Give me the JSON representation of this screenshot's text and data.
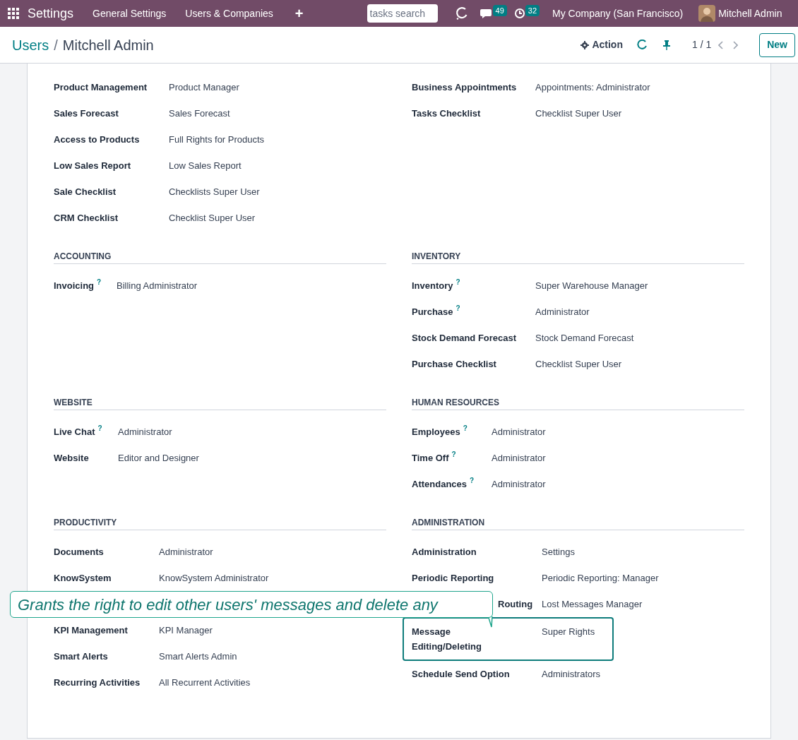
{
  "navbar": {
    "app": "Settings",
    "menu": [
      "General Settings",
      "Users & Companies",
      "+"
    ],
    "search": {
      "placeholder": "tasks search"
    },
    "messages_badge": "49",
    "activities_badge": "32",
    "company": "My Company (San Francisco)",
    "user": "Mitchell Admin"
  },
  "breadcrumb": {
    "parent": "Users",
    "separator": "/",
    "current": "Mitchell Admin"
  },
  "toolbar": {
    "action": "Action",
    "pager": "1 / 1",
    "new_button": "New"
  },
  "blocks": [
    {
      "left": {
        "rows": [
          {
            "label": "Product Management",
            "value": "Product Manager"
          },
          {
            "label": "Sales Forecast",
            "value": "Sales Forecast"
          },
          {
            "label": "Access to Products",
            "value": "Full Rights for Products"
          },
          {
            "label": "Low Sales Report",
            "value": "Low Sales Report"
          },
          {
            "label": "Sale Checklist",
            "value": "Checklists Super User"
          },
          {
            "label": "CRM Checklist",
            "value": "Checklist Super User"
          }
        ]
      },
      "right": {
        "rows": [
          {
            "label": "Business Appointments",
            "value": "Appointments: Administrator"
          },
          {
            "label": "Tasks Checklist",
            "value": "Checklist Super User"
          }
        ]
      }
    },
    {
      "left": {
        "title": "ACCOUNTING",
        "rows": [
          {
            "label": "Invoicing",
            "value": "Billing Administrator",
            "help": "?"
          }
        ]
      },
      "right": {
        "title": "INVENTORY",
        "rows": [
          {
            "label": "Inventory",
            "value": "Super Warehouse Manager",
            "help": "?"
          },
          {
            "label": "Purchase",
            "value": "Administrator",
            "help": "?"
          },
          {
            "label": "Stock Demand Forecast",
            "value": "Stock Demand Forecast"
          },
          {
            "label": "Purchase Checklist",
            "value": "Checklist Super User"
          }
        ]
      }
    },
    {
      "left": {
        "title": "WEBSITE",
        "rows": [
          {
            "label": "Live Chat",
            "value": "Administrator",
            "help": "?"
          },
          {
            "label": "Website",
            "value": "Editor and Designer"
          }
        ]
      },
      "right": {
        "title": "HUMAN RESOURCES",
        "rows": [
          {
            "label": "Employees",
            "value": "Administrator",
            "help": "?"
          },
          {
            "label": "Time Off",
            "value": "Administrator",
            "help": "?"
          },
          {
            "label": "Attendances",
            "value": "Administrator",
            "help": "?"
          }
        ]
      }
    },
    {
      "left": {
        "title": "PRODUCTIVITY",
        "rows": [
          {
            "label": "Documents",
            "value": "Administrator"
          },
          {
            "label": "KnowSystem",
            "value": "KnowSystem Administrator"
          },
          {
            "kind": "tooltip",
            "text": "Grants the right to edit other users' messages and delete any"
          },
          {
            "label": "KPI Management",
            "value": "KPI Manager"
          },
          {
            "label": "Smart Alerts",
            "value": "Smart Alerts Admin"
          },
          {
            "label": "Recurring Activities",
            "value": "All Recurrent Activities"
          }
        ]
      },
      "right": {
        "title": "ADMINISTRATION",
        "rows": [
          {
            "label": "Administration",
            "value": "Settings"
          },
          {
            "label": "Periodic Reporting",
            "value": "Periodic Reporting: Manager"
          },
          {
            "label": "Routing",
            "value": "Lost Messages Manager",
            "covered": true
          },
          {
            "label": "Message Editing/Deleting",
            "value": "Super Rights",
            "highlighted": true
          },
          {
            "label": "Schedule Send Option",
            "value": "Administrators"
          }
        ]
      }
    }
  ]
}
